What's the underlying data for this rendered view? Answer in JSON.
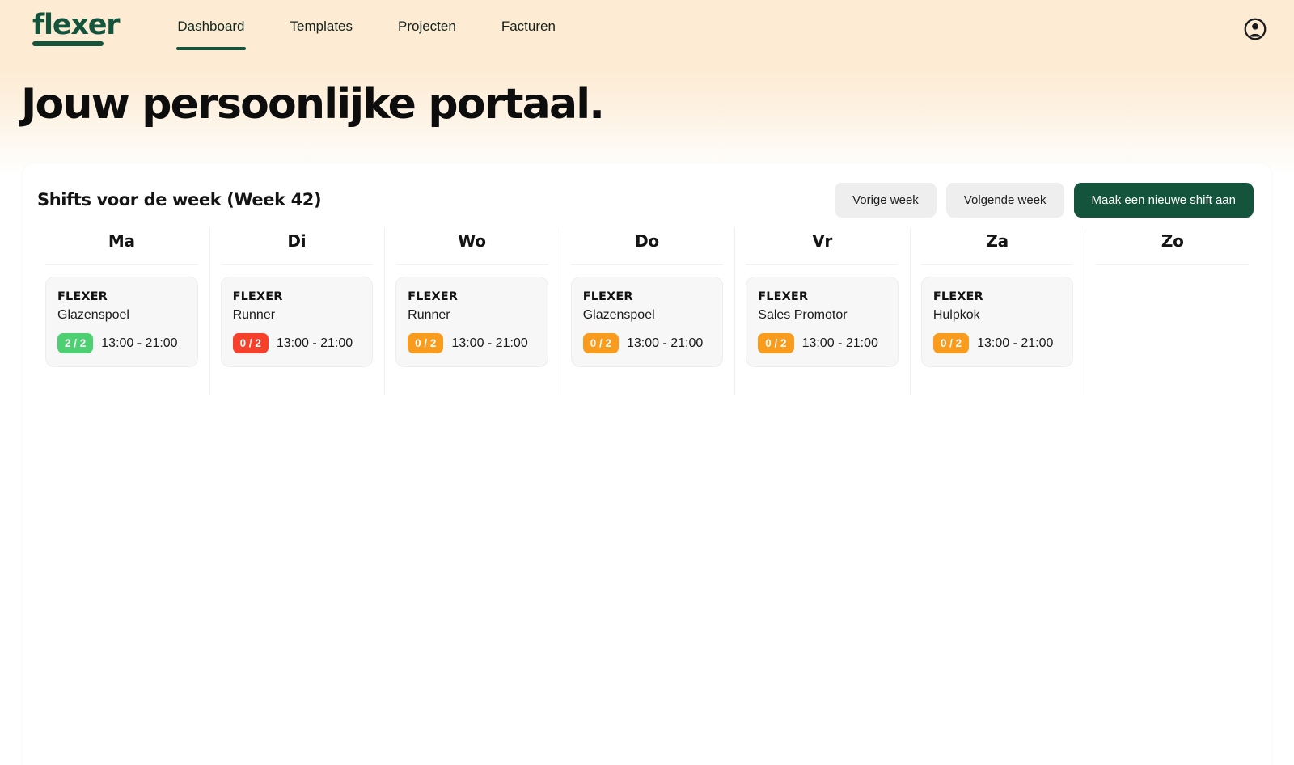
{
  "brand": {
    "logo_text": "flexer",
    "logo_color": "#14543c"
  },
  "nav": {
    "items": [
      {
        "label": "Dashboard",
        "active": true
      },
      {
        "label": "Templates",
        "active": false
      },
      {
        "label": "Projecten",
        "active": false
      },
      {
        "label": "Facturen",
        "active": false
      }
    ],
    "account_icon": "user-circle-icon"
  },
  "hero": {
    "title": "Jouw persoonlijke portaal."
  },
  "panel": {
    "title": "Shifts voor de week (Week 42)",
    "buttons": {
      "prev_week": "Vorige week",
      "next_week": "Volgende week",
      "create_shift": "Maak een nieuwe shift aan"
    }
  },
  "colors": {
    "brand_green": "#14543c",
    "badge_full": "#4dd071",
    "badge_empty_urgent": "#f6402c",
    "badge_empty": "#f99b1c",
    "panel_bg": "#ffffff",
    "card_bg": "#f7f7f8",
    "page_gradient_top": "#fdebd3"
  },
  "week": {
    "days": [
      {
        "name": "Ma",
        "shift": {
          "company": "FLEXER",
          "role": "Glazenspoel",
          "filled": "2 / 2",
          "badge_color": "#4dd071",
          "time": "13:00 - 21:00"
        }
      },
      {
        "name": "Di",
        "shift": {
          "company": "FLEXER",
          "role": "Runner",
          "filled": "0 / 2",
          "badge_color": "#f6402c",
          "time": "13:00 - 21:00"
        }
      },
      {
        "name": "Wo",
        "shift": {
          "company": "FLEXER",
          "role": "Runner",
          "filled": "0 / 2",
          "badge_color": "#f99b1c",
          "time": "13:00 - 21:00"
        }
      },
      {
        "name": "Do",
        "shift": {
          "company": "FLEXER",
          "role": "Glazenspoel",
          "filled": "0 / 2",
          "badge_color": "#f99b1c",
          "time": "13:00 - 21:00"
        }
      },
      {
        "name": "Vr",
        "shift": {
          "company": "FLEXER",
          "role": "Sales Promotor",
          "filled": "0 / 2",
          "badge_color": "#f99b1c",
          "time": "13:00 - 21:00"
        }
      },
      {
        "name": "Za",
        "shift": {
          "company": "FLEXER",
          "role": "Hulpkok",
          "filled": "0 / 2",
          "badge_color": "#f99b1c",
          "time": "13:00 - 21:00"
        }
      },
      {
        "name": "Zo",
        "shift": null
      }
    ]
  }
}
